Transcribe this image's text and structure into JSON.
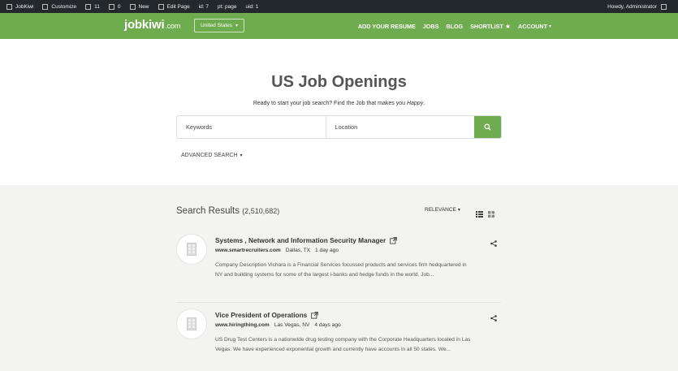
{
  "adminbar": {
    "items": [
      {
        "label": "JobKiwi",
        "icon": "wordpress-icon"
      },
      {
        "label": "Customize",
        "icon": "customize-icon"
      },
      {
        "label": "11",
        "icon": "updates-icon"
      },
      {
        "label": "0",
        "icon": "comments-icon"
      },
      {
        "label": "New",
        "icon": "new-icon"
      },
      {
        "label": "Edit Page",
        "icon": "edit-icon"
      },
      {
        "label": "id: 7",
        "icon": ""
      },
      {
        "label": "pt: page",
        "icon": ""
      },
      {
        "label": "uid: 1",
        "icon": ""
      }
    ],
    "howdy": "Howdy, Administrator"
  },
  "nav": {
    "logo_main": "jobkiwi",
    "logo_suffix": ".com",
    "country": "United States",
    "menu": [
      "ADD YOUR RESUME",
      "JOBS",
      "BLOG",
      "SHORTLIST",
      "ACCOUNT"
    ]
  },
  "hero": {
    "title": "US Job Openings",
    "subtitle": "Ready to start your job search? Find the Job that makes you",
    "subtitle_em": "Happy",
    "subtitle_end": ".",
    "keywords_placeholder": "Keywords",
    "location_placeholder": "Location",
    "advanced": "ADVANCED SEARCH"
  },
  "results": {
    "title": "Search Results",
    "count": "(2,510,682)",
    "sort": "RELEVANCE",
    "jobs": [
      {
        "title": "Systems , Network and Information Security Manager",
        "source": "www.smartrecruiters.com",
        "location": "Dallas, TX",
        "age": "1 day ago",
        "description": "Company Description Vichara is a Financial Services focussed products and services firm hedquartered in NY and building systems for some of the largest i-banks and hedge funds in the world. Job..."
      },
      {
        "title": "Vice President of Operations",
        "source": "www.hiringthing.com",
        "location": "Las Vegas, NV",
        "age": "4 days ago",
        "description": "US Drug Test Centers is a nationwide drug testing company with the Corporate Headquarters located in Las Vegas. We have experienced exponential growth and currently have accounts in all 50 states. We..."
      }
    ]
  },
  "colors": {
    "brand_green": "#6fab4f",
    "adminbar": "#23282d",
    "results_bg": "#f3f4f2"
  }
}
